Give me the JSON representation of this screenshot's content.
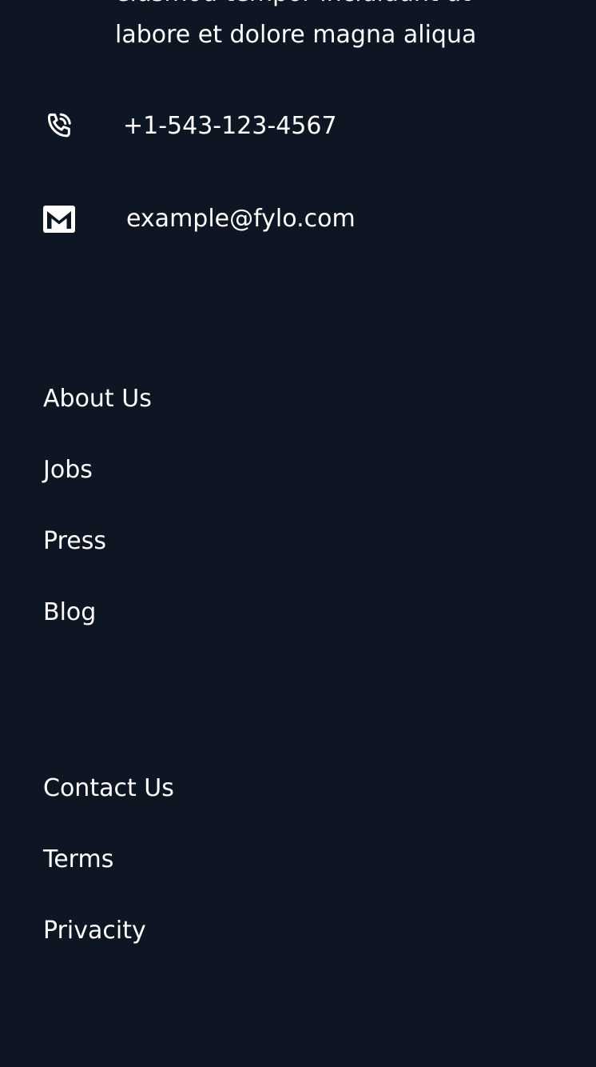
{
  "footer": {
    "address_lines": [
      "eiusmod tempor incididunt ut",
      "labore et dolore magna aliqua"
    ],
    "phone": {
      "icon": "phone-icon",
      "value": "+1-543-123-4567"
    },
    "email": {
      "icon": "mail-icon",
      "value": "example@fylo.com"
    },
    "primary_links": [
      "About Us",
      "Jobs",
      "Press",
      "Blog"
    ],
    "secondary_links": [
      "Contact Us",
      "Terms",
      "Privacity"
    ],
    "colors": {
      "background": "#0e1523",
      "text": "#ffffff"
    }
  }
}
